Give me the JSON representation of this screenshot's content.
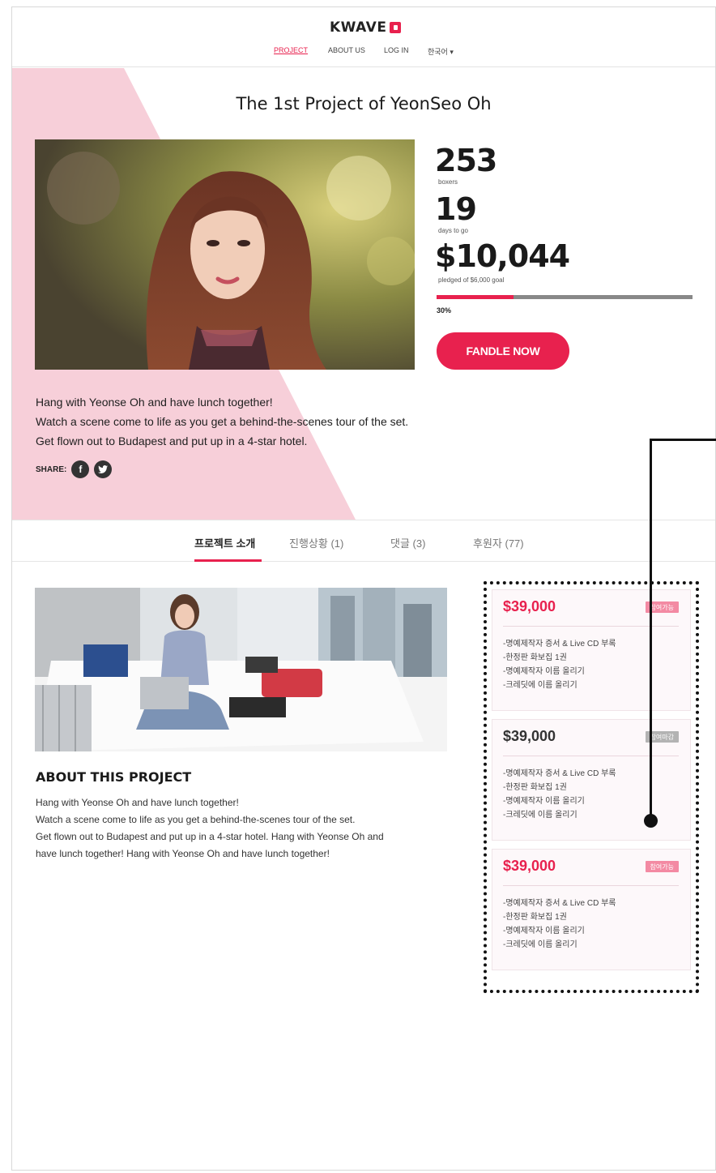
{
  "header": {
    "logo_text": "KWAVE",
    "nav": [
      {
        "label": "PROJECT",
        "active": true
      },
      {
        "label": "ABOUT US",
        "active": false
      },
      {
        "label": "LOG IN",
        "active": false
      },
      {
        "label": "한국어 ▾",
        "active": false
      }
    ]
  },
  "hero": {
    "title": "The 1st Project of YeonSeo Oh",
    "backers": {
      "value": "253",
      "label": "boxers"
    },
    "days": {
      "value": "19",
      "label": "days to go"
    },
    "pledged": {
      "value": "$10,044",
      "label": "pledged of $6,000 goal"
    },
    "progress_percent": 30,
    "progress_label": "30%",
    "cta_label": "FANDLE NOW",
    "description": [
      "Hang with Yeonse Oh and have lunch together!",
      "Watch a scene come to life as you get a behind-the-scenes tour of the set.",
      "Get flown out to Budapest and put up in a 4-star hotel."
    ],
    "share_label": "SHARE:",
    "share_icons": [
      "facebook-icon",
      "twitter-icon"
    ]
  },
  "tabs": [
    {
      "label": "프로젝트 소개",
      "active": true
    },
    {
      "label": "진행상황 (1)",
      "active": false
    },
    {
      "label": "댓글 (3)",
      "active": false
    },
    {
      "label": "후원자 (77)",
      "active": false
    }
  ],
  "about": {
    "title": "ABOUT THIS PROJECT",
    "lines": [
      "Hang with Yeonse Oh and have lunch together!",
      "Watch a scene come to life as you get a behind-the-scenes tour of the set.",
      "Get flown out to Budapest and put up in a 4-star hotel. Hang with Yeonse Oh and",
      "have lunch together! Hang with Yeonse Oh and have lunch together!"
    ]
  },
  "rewards": [
    {
      "price": "$39,000",
      "badge": "참여가능",
      "available": true,
      "items": [
        "-명예제작자 증서 & Live CD 부록",
        "-한정판 화보집 1권",
        "-명예제작자 이름 올리기",
        "-크레딧에 이름 올리기"
      ]
    },
    {
      "price": "$39,000",
      "badge": "참여마감",
      "available": false,
      "items": [
        "-명예제작자 증서 & Live CD 부록",
        "-한정판 화보집 1권",
        "-명예제작자 이름 올리기",
        "-크레딧에 이름 올리기"
      ]
    },
    {
      "price": "$39,000",
      "badge": "참여가능",
      "available": true,
      "items": [
        "-명예제작자 증서 & Live CD 부록",
        "-한정판 화보집 1권",
        "-명예제작자 이름 올리기",
        "-크레딧에 이름 올리기"
      ]
    }
  ],
  "colors": {
    "accent": "#e8214e",
    "hero_pink": "#f7cfd9",
    "badge_available": "#f38aa3",
    "badge_closed": "#b3b3b3"
  }
}
